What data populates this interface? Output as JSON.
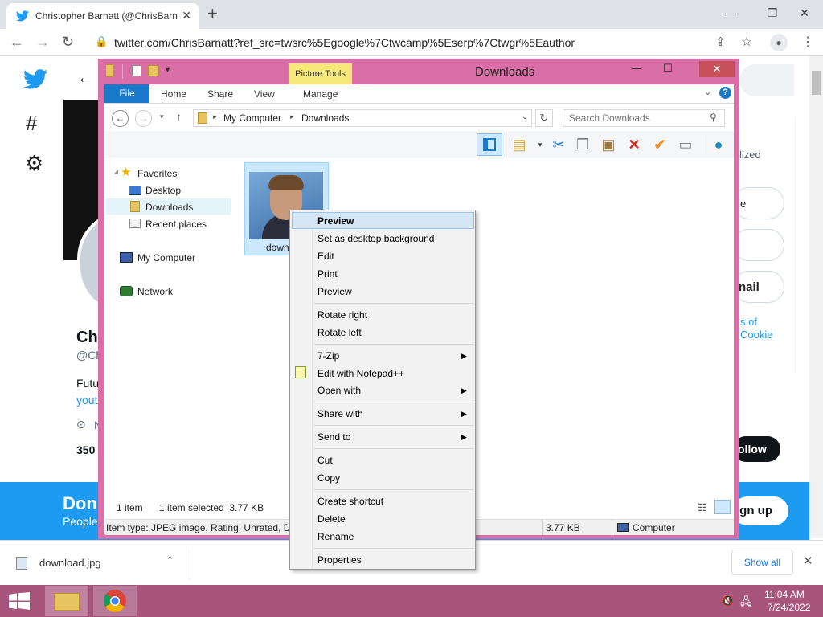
{
  "browser": {
    "tab_title": "Christopher Barnatt (@ChrisBarnatt",
    "tab_close": "✕",
    "new_tab": "+",
    "url": "twitter.com/ChrisBarnatt?ref_src=twsrc%5Egoogle%7Ctwcamp%5Eserp%7Ctwgr%5Eauthor",
    "window_controls": [
      "—",
      "❐",
      "✕"
    ]
  },
  "twitter": {
    "name_partial": "Ch",
    "handle_partial": "@Ch",
    "bio_partial": "Futu",
    "link_partial": "yout",
    "location_partial": "N",
    "count_partial": "350",
    "right_text_1": "lized",
    "right_text_2": "e",
    "right_text_3": "nail",
    "right_link_1": "s of",
    "right_link_2": "Cookie",
    "follow_partial": "ollow",
    "signup_title": "Don",
    "signup_sub": "People",
    "signup_button": "ign up"
  },
  "download_bar": {
    "file": "download.jpg",
    "show_all": "Show all"
  },
  "taskbar": {
    "time": "11:04 AM",
    "date": "7/24/2022"
  },
  "explorer": {
    "title": "Downloads",
    "picture_tools": "Picture Tools",
    "tabs": [
      "File",
      "Home",
      "Share",
      "View",
      "Manage"
    ],
    "path": [
      "My Computer",
      "Downloads"
    ],
    "search_placeholder": "Search Downloads",
    "nav": {
      "favorites": "Favorites",
      "desktop": "Desktop",
      "downloads": "Downloads",
      "recent": "Recent places",
      "computer": "My Computer",
      "network": "Network"
    },
    "file_label": "down",
    "status": {
      "items": "1 item",
      "selected": "1 item selected  3.77 KB",
      "details": "Item type: JPEG image, Rating: Unrated, Din",
      "size": "3.77 KB",
      "location": "Computer"
    }
  },
  "context_menu": {
    "items": [
      "Preview",
      "Set as desktop background",
      "Edit",
      "Print",
      "Preview",
      "Rotate right",
      "Rotate left",
      "7-Zip",
      "Edit with Notepad++",
      "Open with",
      "Share with",
      "Send to",
      "Cut",
      "Copy",
      "Create shortcut",
      "Delete",
      "Rename",
      "Properties"
    ]
  }
}
